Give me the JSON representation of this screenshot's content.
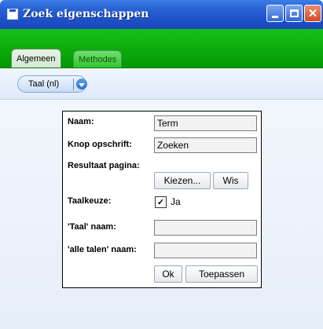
{
  "window": {
    "title": "Zoek eigenschappen",
    "minimize_icon": "minimize-icon",
    "maximize_icon": "maximize-icon",
    "close_icon": "close-icon",
    "close_glyph": "✕"
  },
  "tabs": [
    {
      "label": "Algemeen",
      "active": true
    },
    {
      "label": "Methodes",
      "active": false
    }
  ],
  "toolbar": {
    "language_selected": "Taal (nl)",
    "dropdown_icon": "chevron-down-icon"
  },
  "form": {
    "naam_label": "Naam:",
    "naam_value": "Term",
    "knop_label": "Knop opschrift:",
    "knop_value": "Zoeken",
    "resultaat_label": "Resultaat pagina:",
    "kiezen_button": "Kiezen...",
    "wis_button": "Wis",
    "taalkeuze_label": "Taalkeuze:",
    "taalkeuze_checked": true,
    "taalkeuze_check_glyph": "✓",
    "taalkeuze_option": "Ja",
    "taal_naam_label": "'Taal' naam:",
    "taal_naam_value": "",
    "alle_talen_label": "'alle talen' naam:",
    "alle_talen_value": "",
    "ok_button": "Ok",
    "toepassen_button": "Toepassen"
  },
  "colors": {
    "titlebar": "#1d50c8",
    "tabbar": "#0aa80a",
    "close": "#d04a1e"
  }
}
